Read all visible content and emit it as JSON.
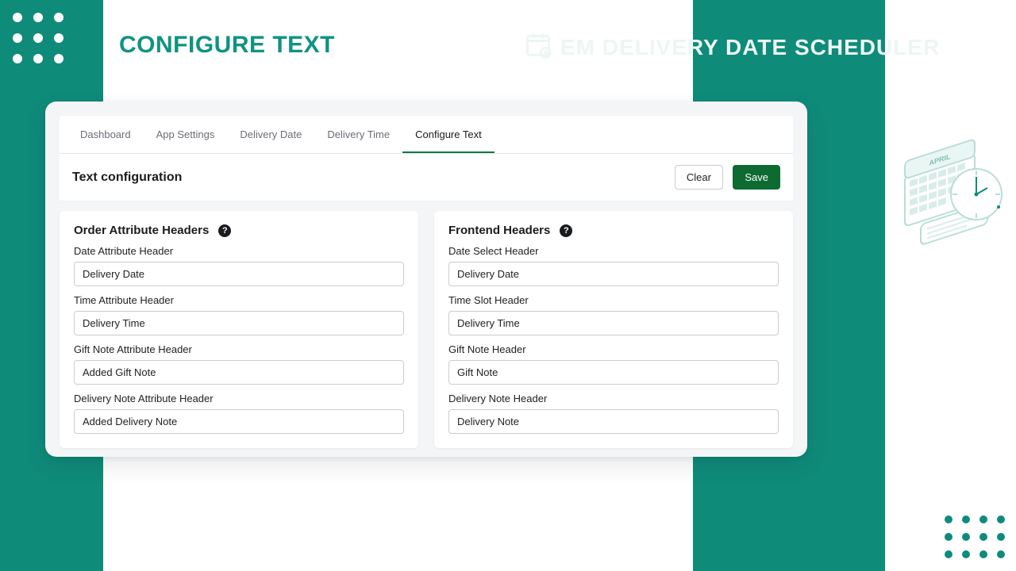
{
  "page": {
    "title": "CONFIGURE TEXT",
    "product": "EM DELIVERY DATE SCHEDULER"
  },
  "tabs": [
    {
      "label": "Dashboard"
    },
    {
      "label": "App Settings"
    },
    {
      "label": "Delivery Date"
    },
    {
      "label": "Delivery Time"
    },
    {
      "label": "Configure Text"
    }
  ],
  "active_tab": 4,
  "section": {
    "title": "Text configuration",
    "clear": "Clear",
    "save": "Save"
  },
  "left_panel": {
    "heading": "Order Attribute Headers",
    "fields": [
      {
        "label": "Date Attribute Header",
        "value": "Delivery Date"
      },
      {
        "label": "Time Attribute Header",
        "value": "Delivery Time"
      },
      {
        "label": "Gift Note Attribute Header",
        "value": "Added Gift Note"
      },
      {
        "label": "Delivery Note Attribute Header",
        "value": "Added Delivery Note"
      }
    ]
  },
  "right_panel": {
    "heading": "Frontend Headers",
    "fields": [
      {
        "label": "Date Select Header",
        "value": "Delivery Date"
      },
      {
        "label": "Time Slot Header",
        "value": "Delivery Time"
      },
      {
        "label": "Gift Note Header",
        "value": "Gift Note"
      },
      {
        "label": "Delivery Note Header",
        "value": "Delivery Note"
      }
    ]
  }
}
